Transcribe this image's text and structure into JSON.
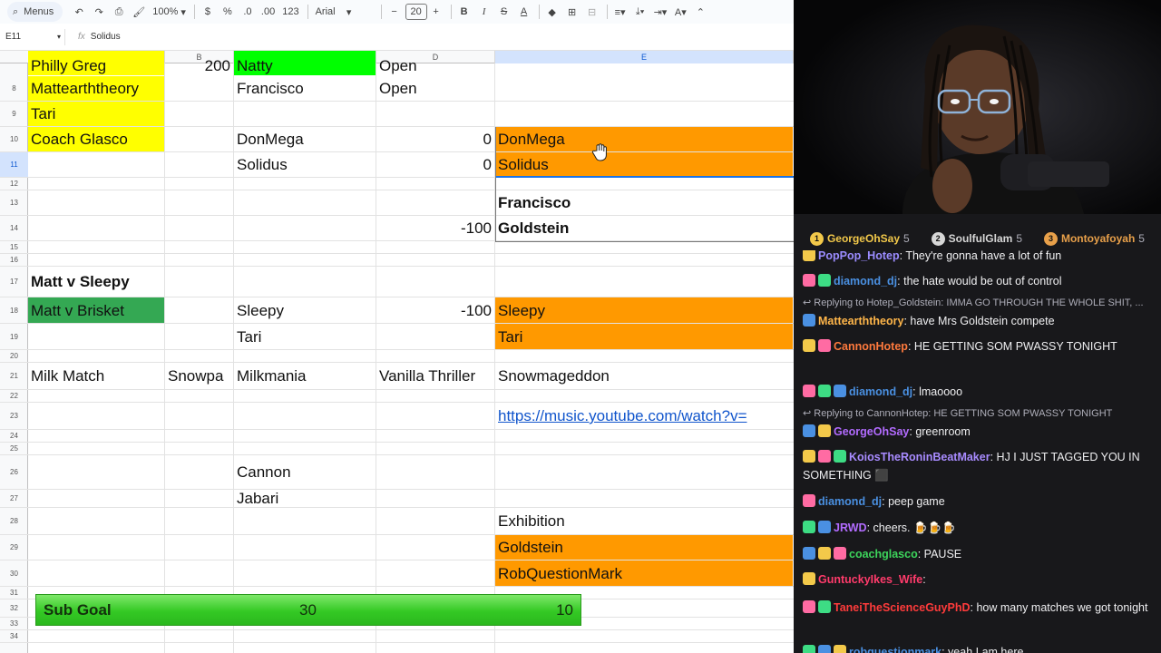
{
  "toolbar": {
    "menus_label": "Menus",
    "zoom": "100%",
    "currency_symbol": "$",
    "percent_symbol": "%",
    "decrease_decimals": ".0",
    "increase_decimals": ".00",
    "number_format": "123",
    "font_name": "Arial",
    "font_size": "20"
  },
  "formula_bar": {
    "cell_ref": "E11",
    "value": "Solidus"
  },
  "columns": [
    "A",
    "B",
    "C",
    "D",
    "E"
  ],
  "selected_column": "E",
  "selected_row": "11",
  "rows": [
    "8",
    "9",
    "10",
    "11",
    "12",
    "13",
    "14",
    "15",
    "16",
    "17",
    "18",
    "19",
    "20",
    "21",
    "22",
    "23",
    "24",
    "25",
    "26",
    "27",
    "28",
    "29",
    "30",
    "31",
    "32",
    "33",
    "34"
  ],
  "cells": {
    "r7": {
      "a": "Philly Greg",
      "b": "200",
      "c": "Natty",
      "d": "Open"
    },
    "r8": {
      "a": "Mattearththeory",
      "c": "Francisco",
      "d": "Open"
    },
    "r9": {
      "a": "Tari"
    },
    "r10": {
      "a": "Coach Glasco",
      "c": "DonMega",
      "d": "0",
      "e": "DonMega"
    },
    "r11": {
      "c": "Solidus",
      "d": "0",
      "e": "Solidus"
    },
    "r13": {
      "e": "Francisco"
    },
    "r14": {
      "d": "-100",
      "e": "Goldstein"
    },
    "r17": {
      "a": "Matt v Sleepy"
    },
    "r18": {
      "a": "Matt v Brisket",
      "c": "Sleepy",
      "d": "-100",
      "e": "Sleepy"
    },
    "r19": {
      "c": "Tari",
      "e": "Tari"
    },
    "r21": {
      "a": "Milk Match",
      "b": "Snowpa",
      "c": "Milkmania",
      "d": "Vanilla Thriller",
      "e": "Snowmageddon"
    },
    "r23": {
      "e": "https://music.youtube.com/watch?v="
    },
    "r26": {
      "c": "Cannon"
    },
    "r27": {
      "c": "Jabari"
    },
    "r28": {
      "e": "Exhibition"
    },
    "r29": {
      "e": "Goldstein"
    },
    "r30": {
      "e": "RobQuestionMark"
    }
  },
  "sub_goal": {
    "label": "Sub Goal",
    "current": "30",
    "target": "10"
  },
  "colors": {
    "yellow": "#ffff00",
    "orange": "#ff9900",
    "green": "#34a853",
    "chat_bg": "#18181b"
  },
  "leaderboard": [
    {
      "rank": "1",
      "name": "GeorgeOhSay",
      "score": "5",
      "color": "#f3c94a"
    },
    {
      "rank": "2",
      "name": "SoulfulGlam",
      "score": "5",
      "color": "#d7d7d7"
    },
    {
      "rank": "3",
      "name": "Montoyafoyah",
      "score": "5",
      "color": "#e8a04a"
    }
  ],
  "chat": {
    "messages": [
      {
        "user": "PopPop_Hotep",
        "user_color": "#9b8cff",
        "text": ": They're gonna have a lot of fun"
      },
      {
        "user": "diamond_dj",
        "user_color": "#4a90e2",
        "text": ": the hate would be out of control"
      },
      {
        "reply_to": "Replying to Hotep_Goldstein: IMMA GO THROUGH THE WHOLE SHIT, ..."
      },
      {
        "user": "Mattearththeory",
        "user_color": "#ffb64a",
        "text": ": have Mrs Goldstein compete"
      },
      {
        "user": "CannonHotep",
        "user_color": "#ff7a3d",
        "text": ": HE GETTING SOM PWASSY TONIGHT"
      },
      {
        "user": "diamond_dj",
        "user_color": "#4a90e2",
        "text": ": lmaoooo"
      },
      {
        "reply_to": "Replying to CannonHotep: HE GETTING SOM PWASSY TONIGHT"
      },
      {
        "user": "GeorgeOhSay",
        "user_color": "#b26bff",
        "text": ": greenroom"
      },
      {
        "user": "KoiosTheRoninBeatMaker",
        "user_color": "#a88bff",
        "text": ": HJ I JUST TAGGED YOU IN SOMETHING ⬛"
      },
      {
        "user": "diamond_dj",
        "user_color": "#4a90e2",
        "text": ": peep game"
      },
      {
        "user": "JRWD",
        "user_color": "#b26bff",
        "text": ": cheers. 🍺🍺🍺"
      },
      {
        "user": "coachglasco",
        "user_color": "#3dd65c",
        "text": ": PAUSE"
      },
      {
        "user": "GuntuckyIkes_Wife",
        "user_color": "#ff3b6b",
        "text": ":"
      },
      {
        "user": "TaneiTheScienceGuyPhD",
        "user_color": "#ff3b3b",
        "text": ": how many matches we got tonight"
      },
      {
        "user": "robquestionmark",
        "user_color": "#4a90e2",
        "text": ": yeah I am here"
      }
    ]
  }
}
